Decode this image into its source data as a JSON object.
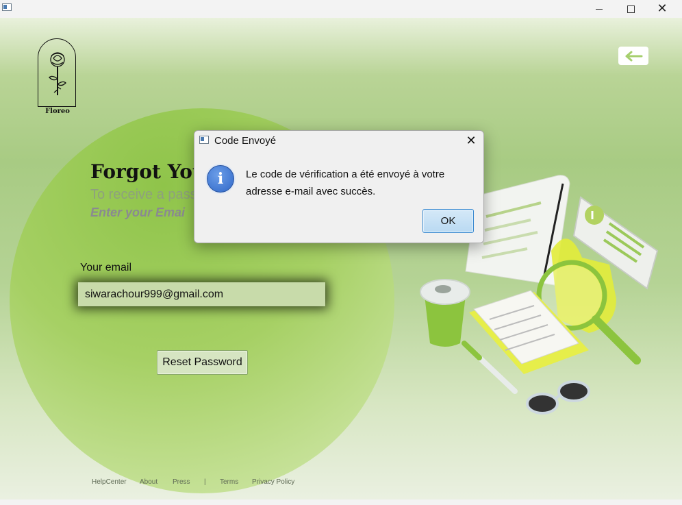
{
  "window": {
    "app_icon": "java-app-icon"
  },
  "brand": {
    "name": "Floreo"
  },
  "page": {
    "heading": "Forgot You",
    "subtitle": "To receive a pass",
    "instruction": "Enter your Emai",
    "email_label": "Your email",
    "email_value": "siwarachour999@gmail.com",
    "reset_button": "Reset Password"
  },
  "footer": {
    "links": [
      "HelpCenter",
      "About",
      "Press",
      "|",
      "Terms",
      "Privacy Policy"
    ]
  },
  "dialog": {
    "title": "Code Envoyé",
    "message_line1": "Le code de vérification a été envoyé à votre",
    "message_line2": "adresse e-mail avec succès.",
    "ok_label": "OK",
    "icon": "info-icon"
  },
  "colors": {
    "accent_green": "#a6d064",
    "dialog_button_border": "#3b8ad0",
    "info_blue": "#2f67c8"
  }
}
